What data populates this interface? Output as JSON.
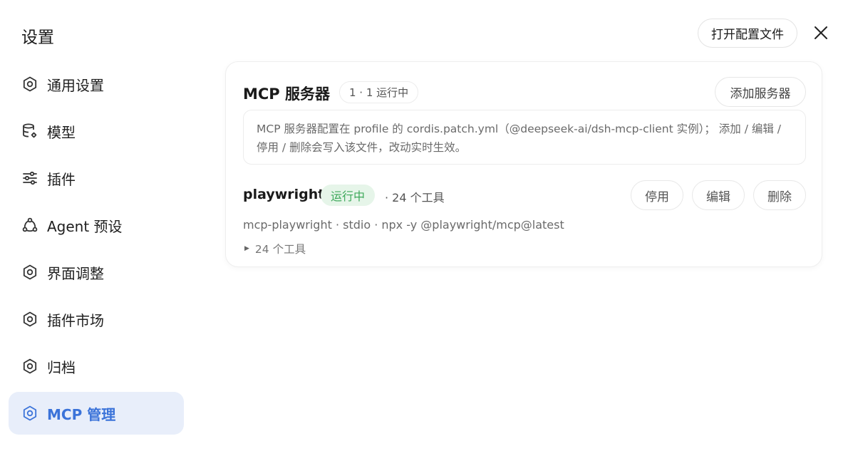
{
  "dialog": {
    "title": "设置",
    "open_config_label": "打开配置文件"
  },
  "sidebar": {
    "items": [
      {
        "label": "通用设置",
        "icon": "gear-icon"
      },
      {
        "label": "模型",
        "icon": "database-gear-icon"
      },
      {
        "label": "插件",
        "icon": "sliders-icon"
      },
      {
        "label": "Agent 预设",
        "icon": "network-icon"
      },
      {
        "label": "界面调整",
        "icon": "gear-icon"
      },
      {
        "label": "插件市场",
        "icon": "gear-icon"
      },
      {
        "label": "归档",
        "icon": "gear-icon"
      },
      {
        "label": "MCP 管理",
        "icon": "gear-icon",
        "active": true
      }
    ]
  },
  "mcp": {
    "title": "MCP 服务器",
    "count_badge": "1 · 1 运行中",
    "add_label": "添加服务器",
    "info": "MCP 服务器配置在 profile 的 cordis.patch.yml（@deepseek-ai/dsh-mcp-client 实例）； 添加 / 编辑 / 停用 / 删除会写入该文件，改动实时生效。",
    "servers": [
      {
        "name": "playwright",
        "status": "运行中",
        "tool_count": "· 24 个工具",
        "meta": "mcp-playwright · stdio · npx -y @playwright/mcp@latest",
        "tools_toggle": "24 个工具",
        "disable_label": "停用",
        "edit_label": "编辑",
        "delete_label": "删除"
      }
    ]
  },
  "colors": {
    "accent": "#3b73d9",
    "active_bg": "#e8eefa",
    "running_bg": "#e6f5e9",
    "running_text": "#3ea85a"
  }
}
